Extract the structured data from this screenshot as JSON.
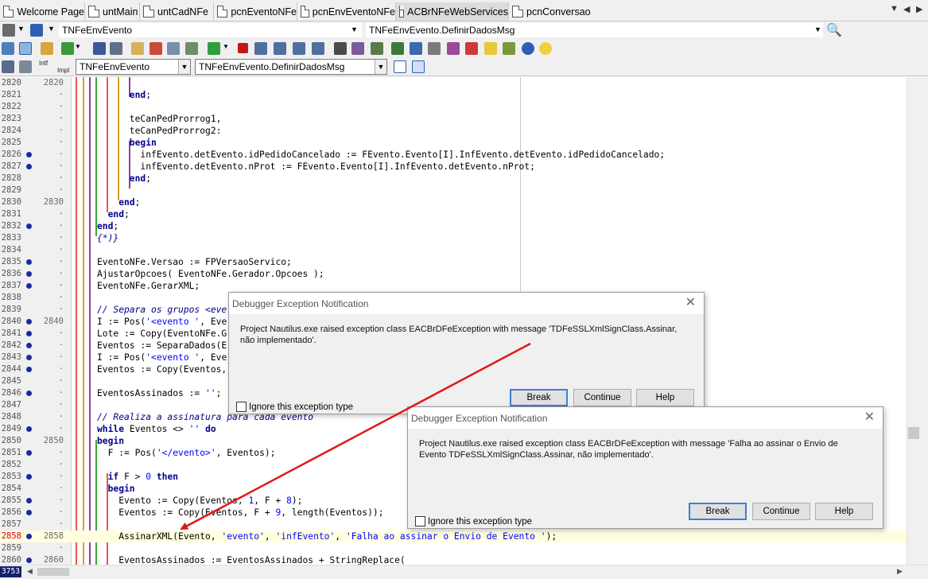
{
  "tabs": [
    {
      "label": "Welcome Page",
      "active": false
    },
    {
      "label": "untMain",
      "active": false
    },
    {
      "label": "untCadNFe",
      "active": false
    },
    {
      "label": "pcnEventoNFe",
      "active": false
    },
    {
      "label": "pcnEnvEventoNFe",
      "active": false
    },
    {
      "label": "ACBrNFeWebServices",
      "active": true
    },
    {
      "label": "pcnConversao",
      "active": false
    }
  ],
  "toolbar": {
    "class_combo": "TNFeEnvEvento",
    "method_combo": "TNFeEnvEvento.DefinirDadosMsg",
    "class_combo_2": "TNFeEnvEvento",
    "method_combo_2": "TNFeEnvEvento.DefinirDadosMsg",
    "intf_label": "Intf",
    "impl_label": "Impl"
  },
  "editor": {
    "current_line": "3753",
    "lines": [
      {
        "n": "2820",
        "dot": false,
        "g": "2820",
        "tokens": []
      },
      {
        "n": "2821",
        "dot": false,
        "g": "·",
        "tokens": [
          [
            "kw",
            "      end"
          ],
          [
            "sym",
            ";"
          ]
        ]
      },
      {
        "n": "2822",
        "dot": false,
        "g": "·",
        "tokens": []
      },
      {
        "n": "2823",
        "dot": false,
        "g": "·",
        "tokens": [
          [
            "sym",
            "      teCanPedProrrog1,"
          ]
        ]
      },
      {
        "n": "2824",
        "dot": false,
        "g": "·",
        "tokens": [
          [
            "sym",
            "      teCanPedProrrog2:"
          ]
        ]
      },
      {
        "n": "2825",
        "dot": false,
        "g": "·",
        "tokens": [
          [
            "kw",
            "      begin"
          ]
        ]
      },
      {
        "n": "2826",
        "dot": true,
        "g": "·",
        "tokens": [
          [
            "sym",
            "        infEvento.detEvento.idPedidoCancelado := FEvento.Evento[I].InfEvento.detEvento.idPedidoCancelado;"
          ]
        ]
      },
      {
        "n": "2827",
        "dot": true,
        "g": "·",
        "tokens": [
          [
            "sym",
            "        infEvento.detEvento.nProt := FEvento.Evento[I].InfEvento.detEvento.nProt;"
          ]
        ]
      },
      {
        "n": "2828",
        "dot": false,
        "g": "·",
        "tokens": [
          [
            "kw",
            "      end"
          ],
          [
            "sym",
            ";"
          ]
        ]
      },
      {
        "n": "2829",
        "dot": false,
        "g": "·",
        "tokens": []
      },
      {
        "n": "2830",
        "dot": false,
        "g": "2830",
        "tokens": [
          [
            "kw",
            "    end"
          ],
          [
            "sym",
            ";"
          ]
        ]
      },
      {
        "n": "2831",
        "dot": false,
        "g": "·",
        "tokens": [
          [
            "kw",
            "  end"
          ],
          [
            "sym",
            ";"
          ]
        ]
      },
      {
        "n": "2832",
        "dot": true,
        "g": "·",
        "tokens": [
          [
            "kw",
            "end"
          ],
          [
            "sym",
            ";"
          ]
        ]
      },
      {
        "n": "2833",
        "dot": false,
        "g": "·",
        "tokens": [
          [
            "cmt",
            "{*)}"
          ]
        ]
      },
      {
        "n": "2834",
        "dot": false,
        "g": "·",
        "tokens": []
      },
      {
        "n": "2835",
        "dot": true,
        "g": "·",
        "tokens": [
          [
            "sym",
            "EventoNFe.Versao := FPVersaoServico;"
          ]
        ]
      },
      {
        "n": "2836",
        "dot": true,
        "g": "·",
        "tokens": [
          [
            "sym",
            "AjustarOpcoes( EventoNFe.Gerador.Opcoes );"
          ]
        ]
      },
      {
        "n": "2837",
        "dot": true,
        "g": "·",
        "tokens": [
          [
            "sym",
            "EventoNFe.GerarXML;"
          ]
        ]
      },
      {
        "n": "2838",
        "dot": false,
        "g": "·",
        "tokens": []
      },
      {
        "n": "2839",
        "dot": false,
        "g": "·",
        "tokens": [
          [
            "cmt",
            "// Separa os grupos <eve"
          ]
        ]
      },
      {
        "n": "2840",
        "dot": true,
        "g": "2840",
        "tokens": [
          [
            "sym",
            "I := Pos("
          ],
          [
            "str",
            "'<evento '"
          ],
          [
            "sym",
            ", Eve"
          ]
        ]
      },
      {
        "n": "2841",
        "dot": true,
        "g": "·",
        "tokens": [
          [
            "sym",
            "Lote := Copy(EventoNFe.G"
          ]
        ]
      },
      {
        "n": "2842",
        "dot": true,
        "g": "·",
        "tokens": [
          [
            "sym",
            "Eventos := SeparaDados(E"
          ]
        ]
      },
      {
        "n": "2843",
        "dot": true,
        "g": "·",
        "tokens": [
          [
            "sym",
            "I := Pos("
          ],
          [
            "str",
            "'<evento '"
          ],
          [
            "sym",
            ", Eve"
          ]
        ]
      },
      {
        "n": "2844",
        "dot": true,
        "g": "·",
        "tokens": [
          [
            "sym",
            "Eventos := Copy(Eventos,"
          ]
        ]
      },
      {
        "n": "2845",
        "dot": false,
        "g": "·",
        "tokens": []
      },
      {
        "n": "2846",
        "dot": true,
        "g": "·",
        "tokens": [
          [
            "sym",
            "EventosAssinados := "
          ],
          [
            "str",
            "''"
          ],
          [
            "sym",
            ";"
          ]
        ]
      },
      {
        "n": "2847",
        "dot": false,
        "g": "·",
        "tokens": []
      },
      {
        "n": "2848",
        "dot": false,
        "g": "·",
        "tokens": [
          [
            "cmt",
            "// Realiza a assinatura para cada evento"
          ]
        ]
      },
      {
        "n": "2849",
        "dot": true,
        "g": "·",
        "tokens": [
          [
            "kw",
            "while"
          ],
          [
            "sym",
            " Eventos <> "
          ],
          [
            "str",
            "''"
          ],
          [
            "sym",
            " "
          ],
          [
            "kw",
            "do"
          ]
        ]
      },
      {
        "n": "2850",
        "dot": false,
        "g": "2850",
        "tokens": [
          [
            "kw",
            "begin"
          ]
        ]
      },
      {
        "n": "2851",
        "dot": true,
        "g": "·",
        "tokens": [
          [
            "sym",
            "  F := Pos("
          ],
          [
            "str",
            "'</evento>'"
          ],
          [
            "sym",
            ", Eventos);"
          ]
        ]
      },
      {
        "n": "2852",
        "dot": false,
        "g": "·",
        "tokens": []
      },
      {
        "n": "2853",
        "dot": true,
        "g": "·",
        "tokens": [
          [
            "kw",
            "  if"
          ],
          [
            "sym",
            " F > "
          ],
          [
            "numc",
            "0"
          ],
          [
            "sym",
            " "
          ],
          [
            "kw",
            "then"
          ]
        ]
      },
      {
        "n": "2854",
        "dot": false,
        "g": "·",
        "tokens": [
          [
            "kw",
            "  begin"
          ]
        ]
      },
      {
        "n": "2855",
        "dot": true,
        "g": "·",
        "tokens": [
          [
            "sym",
            "    Evento := Copy(Eventos, "
          ],
          [
            "numc",
            "1"
          ],
          [
            "sym",
            ", F + "
          ],
          [
            "numc",
            "8"
          ],
          [
            "sym",
            ");"
          ]
        ]
      },
      {
        "n": "2856",
        "dot": true,
        "g": "·",
        "tokens": [
          [
            "sym",
            "    Eventos := Copy(Eventos, F + "
          ],
          [
            "numc",
            "9"
          ],
          [
            "sym",
            ", length(Eventos));"
          ]
        ]
      },
      {
        "n": "2857",
        "dot": false,
        "g": "·",
        "tokens": []
      },
      {
        "n": "2858",
        "dot": true,
        "g": "2858",
        "cur": true,
        "tokens": [
          [
            "sym",
            "    AssinarXML(Evento, "
          ],
          [
            "str",
            "'evento'"
          ],
          [
            "sym",
            ", "
          ],
          [
            "str",
            "'infEvento'"
          ],
          [
            "sym",
            ", "
          ],
          [
            "str",
            "'Falha ao assinar o Envio de Evento '"
          ],
          [
            "sym",
            ");"
          ]
        ]
      },
      {
        "n": "2859",
        "dot": false,
        "g": "·",
        "tokens": []
      },
      {
        "n": "2860",
        "dot": true,
        "g": "2860",
        "tokens": [
          [
            "sym",
            "    EventosAssinados := EventosAssinados + StringReplace("
          ]
        ]
      }
    ]
  },
  "dialog1": {
    "title": "Debugger Exception Notification",
    "message": "Project Nautilus.exe raised exception class EACBrDFeException with message 'TDFeSSLXmlSignClass.Assinar, não implementado'.",
    "checkbox": "Ignore this exception type",
    "break": "Break",
    "continue": "Continue",
    "help": "Help"
  },
  "dialog2": {
    "title": "Debugger Exception Notification",
    "message": "Project Nautilus.exe raised exception class EACBrDFeException with message 'Falha ao assinar o Envio de Evento TDFeSSLXmlSignClass.Assinar, não implementado'.",
    "checkbox": "Ignore this exception type",
    "break": "Break",
    "continue": "Continue",
    "help": "Help"
  },
  "colors": {
    "annotation_arrow": "#e01818",
    "keyword": "#00008b",
    "string": "#0000ff",
    "breakpoint_dot": "#1b2b9b"
  }
}
